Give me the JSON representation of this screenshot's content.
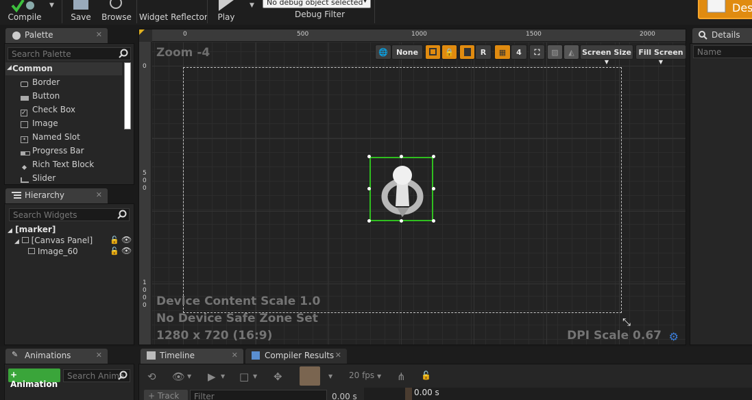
{
  "toolbar": {
    "compile_label": "Compile",
    "save_label": "Save",
    "browse_label": "Browse",
    "widget_reflector_label": "Widget Reflector",
    "play_label": "Play",
    "debug_object_value": "No debug object selected",
    "debug_filter_label": "Debug Filter",
    "designer_label": "Des"
  },
  "palette": {
    "tab_label": "Palette",
    "search_placeholder": "Search Palette",
    "category": "Common",
    "items": [
      {
        "label": "Border",
        "icon": "border-icon"
      },
      {
        "label": "Button",
        "icon": "button-icon"
      },
      {
        "label": "Check Box",
        "icon": "checkbox-icon"
      },
      {
        "label": "Image",
        "icon": "image-icon"
      },
      {
        "label": "Named Slot",
        "icon": "named-slot-icon"
      },
      {
        "label": "Progress Bar",
        "icon": "progress-bar-icon"
      },
      {
        "label": "Rich Text Block",
        "icon": "rich-text-icon"
      },
      {
        "label": "Slider",
        "icon": "slider-icon"
      }
    ]
  },
  "hierarchy": {
    "tab_label": "Hierarchy",
    "search_placeholder": "Search Widgets",
    "root": "[marker]",
    "canvas_panel": "[Canvas Panel]",
    "image_item": "Image_60"
  },
  "designer": {
    "zoom_label": "Zoom -4",
    "ruler_top": [
      "0",
      "500",
      "1000",
      "1500",
      "2000"
    ],
    "ruler_left_0": "0",
    "ruler_left_500": [
      "5",
      "0",
      "0"
    ],
    "ruler_left_1000": [
      "1",
      "0",
      "0",
      "0"
    ],
    "toolbar": {
      "localization": "None",
      "r_label": "R",
      "grid_size": "4",
      "screen_size": "Screen Size",
      "fill_screen": "Fill Screen"
    },
    "device_content_scale": "Device Content Scale 1.0",
    "safe_zone": "No Device Safe Zone Set",
    "resolution": "1280 x 720 (16:9)",
    "dpi_scale": "DPI Scale 0.67"
  },
  "details": {
    "tab_label": "Details",
    "name_placeholder": "Name"
  },
  "animations": {
    "tab_label": "Animations",
    "add_button": "+ Animation",
    "search_placeholder": "Search Anima"
  },
  "timeline": {
    "tab_label": "Timeline",
    "compiler_tab_label": "Compiler Results",
    "fps": "20 fps",
    "track_button": "+ Track",
    "filter_placeholder": "Filter",
    "time_left": "0.00 s",
    "time_head": "0.00 s"
  },
  "colors": {
    "accent": "#e08b10",
    "selection": "#2fbf1f",
    "dpi_gear": "#3b7dd8"
  }
}
